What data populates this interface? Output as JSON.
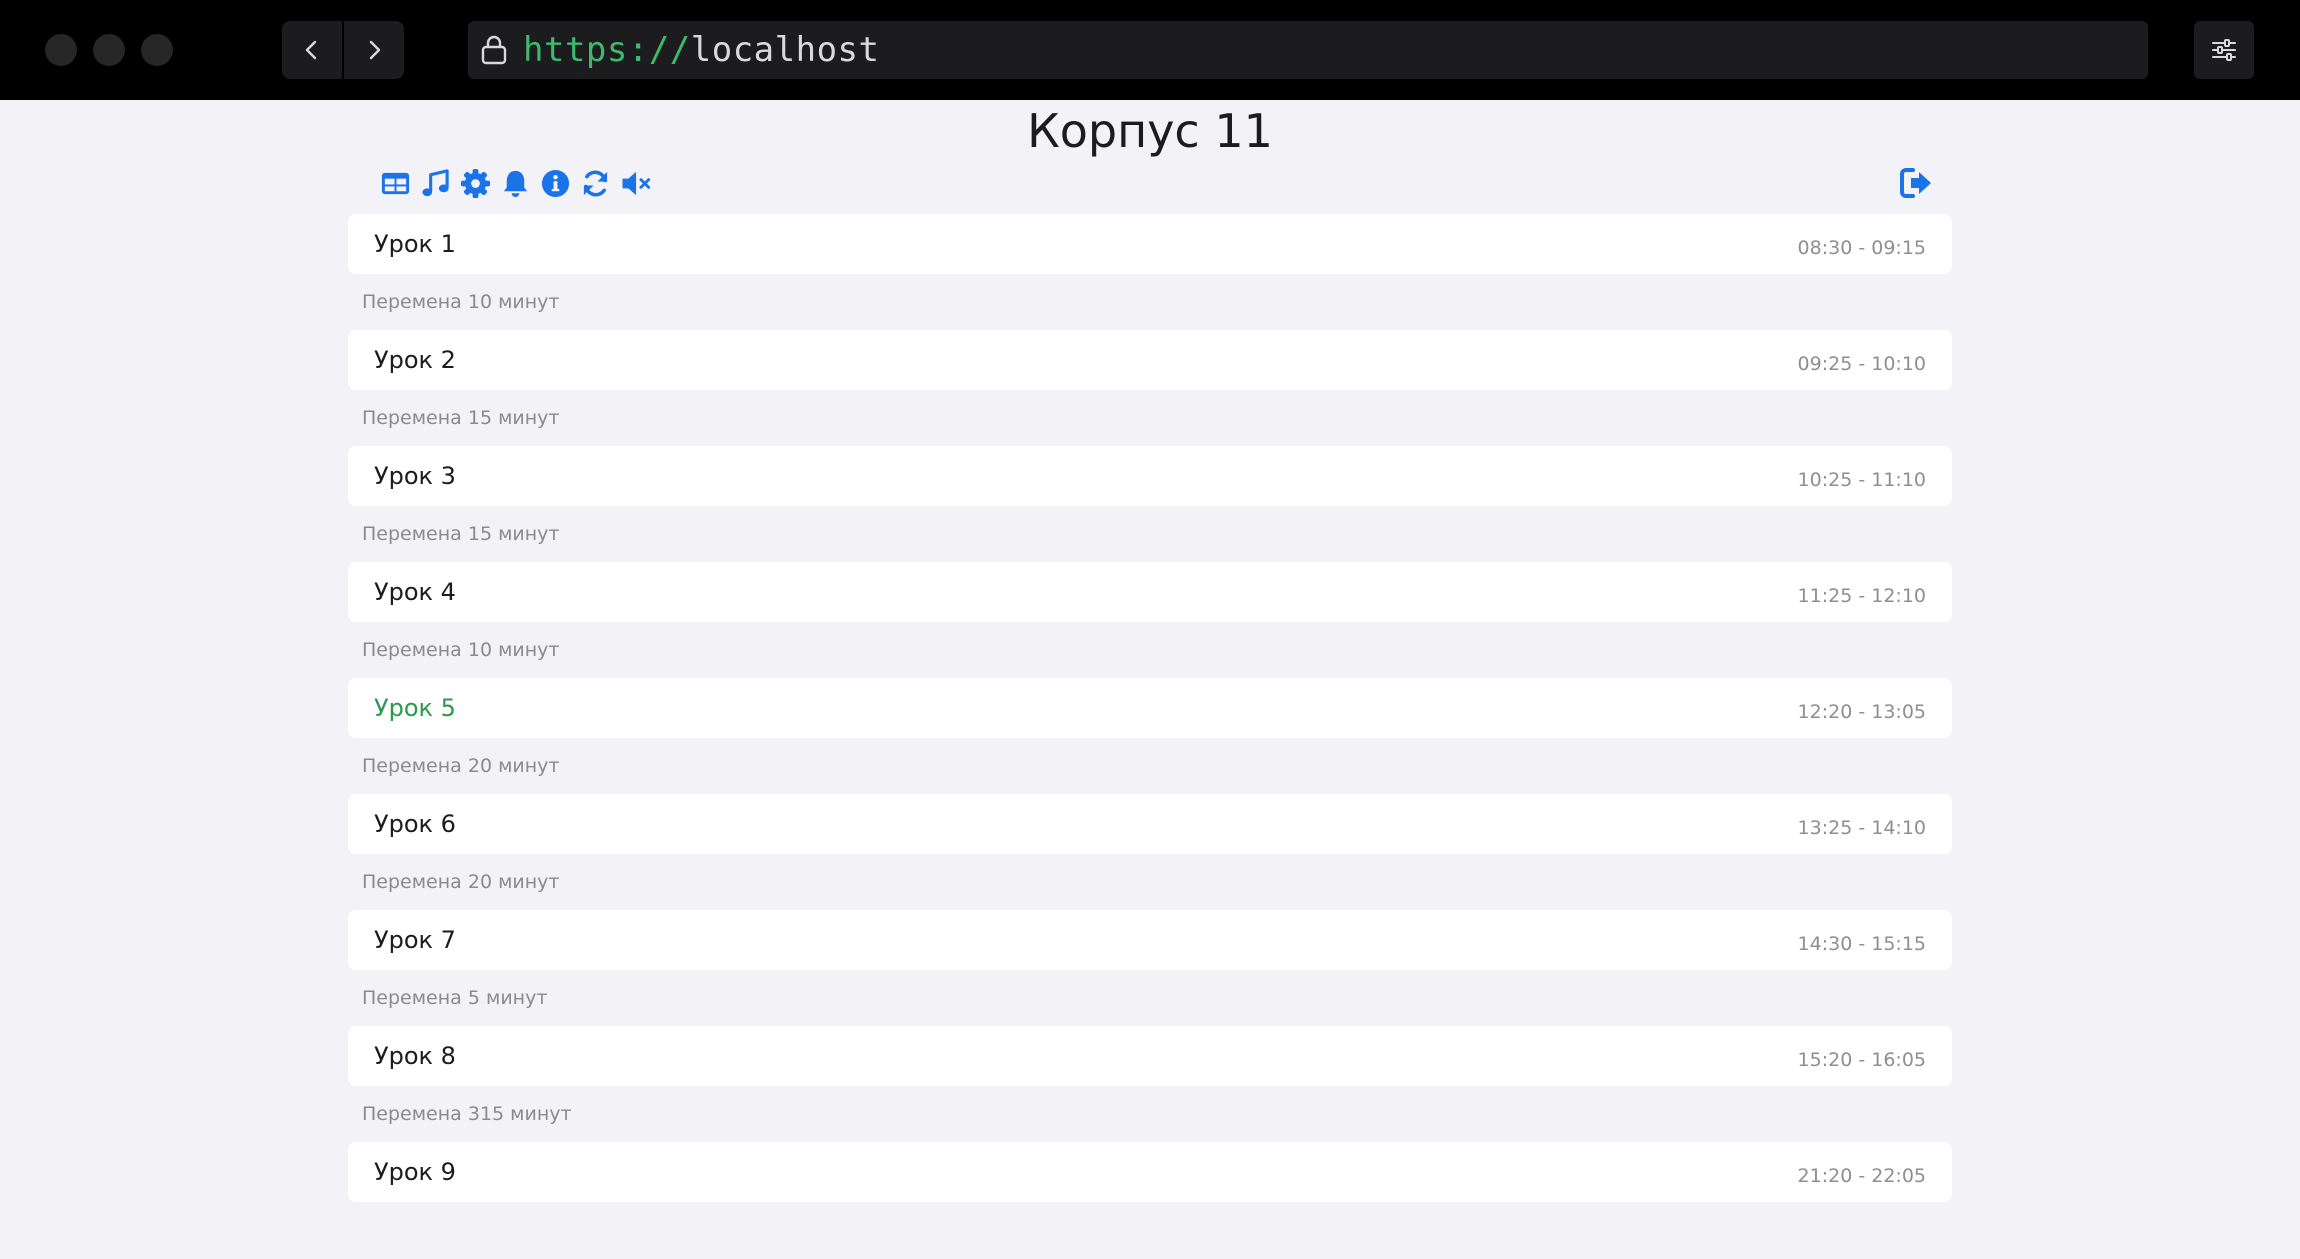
{
  "browser": {
    "url_scheme": "https://",
    "url_host": "localhost"
  },
  "page": {
    "title": "Корпус 11"
  },
  "toolbar": {
    "icons": [
      "table-icon",
      "music-icon",
      "gear-icon",
      "bell-icon",
      "info-icon",
      "refresh-icon",
      "mute-icon"
    ],
    "logout_icon": "logout-icon",
    "accent_color": "#1a73e8"
  },
  "schedule": {
    "current_lesson_color": "#2b9a4a",
    "lessons": [
      {
        "name": "Урок 1",
        "time": "08:30 - 09:15"
      },
      {
        "name": "Урок 2",
        "time": "09:25 - 10:10"
      },
      {
        "name": "Урок 3",
        "time": "10:25 - 11:10"
      },
      {
        "name": "Урок 4",
        "time": "11:25 - 12:10"
      },
      {
        "name": "Урок 5",
        "time": "12:20 - 13:05",
        "current": true
      },
      {
        "name": "Урок 6",
        "time": "13:25 - 14:10"
      },
      {
        "name": "Урок 7",
        "time": "14:30 - 15:15"
      },
      {
        "name": "Урок 8",
        "time": "15:20 - 16:05"
      },
      {
        "name": "Урок 9",
        "time": "21:20 - 22:05"
      }
    ],
    "breaks": [
      "Перемена 10 минут",
      "Перемена 15 минут",
      "Перемена 15 минут",
      "Перемена 10 минут",
      "Перемена 20 минут",
      "Перемена 20 минут",
      "Перемена 5 минут",
      "Перемена 315 минут"
    ]
  }
}
